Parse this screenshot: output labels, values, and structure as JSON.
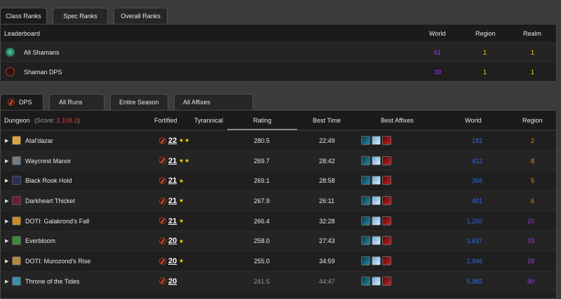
{
  "rank_tabs": [
    "Class Ranks",
    "Spec Ranks",
    "Overall Ranks"
  ],
  "leaderboard": {
    "title": "Leaderboard",
    "columns": [
      "World",
      "Region",
      "Realm"
    ],
    "rows": [
      {
        "name": "All Shamans",
        "icon": "shaman-class-icon",
        "world": "61",
        "region": "1",
        "realm": "1"
      },
      {
        "name": "Shaman DPS",
        "icon": "dps-role-icon",
        "world": "39",
        "region": "1",
        "realm": "1"
      }
    ]
  },
  "run_tabs": [
    "DPS",
    "All Runs",
    "Entire Season",
    "All Affixes"
  ],
  "dungeons": {
    "header": {
      "dungeon": "Dungeon",
      "score_prefix": "(Score:",
      "score_value": "2,108.2",
      "score_suffix": ")",
      "fortified": "Fortified",
      "tyrannical": "Tyrannical",
      "rating": "Rating",
      "best_time": "Best Time",
      "best_affixes": "Best Affixes",
      "world": "World",
      "region": "Region"
    },
    "rows": [
      {
        "name": "Atal'dazar",
        "level": "22",
        "stars": "★★",
        "rating": "280.5",
        "time": "22:49",
        "world": "182",
        "region": "2",
        "region_color": "orange",
        "depleted": false
      },
      {
        "name": "Waycrest Manor",
        "level": "21",
        "stars": "★★",
        "rating": "269.7",
        "time": "28:42",
        "world": "412",
        "region": "8",
        "region_color": "orange",
        "depleted": false
      },
      {
        "name": "Black Rook Hold",
        "level": "21",
        "stars": "★",
        "rating": "269.1",
        "time": "28:58",
        "world": "366",
        "region": "5",
        "region_color": "orange",
        "depleted": false
      },
      {
        "name": "Darkheart Thicket",
        "level": "21",
        "stars": "★",
        "rating": "267.9",
        "time": "26:11",
        "world": "401",
        "region": "6",
        "region_color": "orange",
        "depleted": false
      },
      {
        "name": "DOTI: Galakrond's Fall",
        "level": "21",
        "stars": "★",
        "rating": "266.4",
        "time": "32:28",
        "world": "1,250",
        "region": "20",
        "region_color": "purple",
        "depleted": false
      },
      {
        "name": "Everbloom",
        "level": "20",
        "stars": "★",
        "rating": "258.0",
        "time": "27:43",
        "world": "1,837",
        "region": "33",
        "region_color": "purple",
        "depleted": false
      },
      {
        "name": "DOTI: Murozond's Rise",
        "level": "20",
        "stars": "★",
        "rating": "255.0",
        "time": "34:59",
        "world": "1,946",
        "region": "28",
        "region_color": "purple",
        "depleted": false
      },
      {
        "name": "Throne of the Tides",
        "level": "20",
        "stars": "",
        "rating": "241.5",
        "time": "44:47",
        "world": "5,982",
        "region": "90",
        "region_color": "purple",
        "depleted": true
      }
    ]
  },
  "colors": {
    "purple": "#a335ee",
    "orange": "#ff8000",
    "blue": "#2e6fe8",
    "score_red": "#e0382b",
    "star_gold": "#ffd100"
  }
}
